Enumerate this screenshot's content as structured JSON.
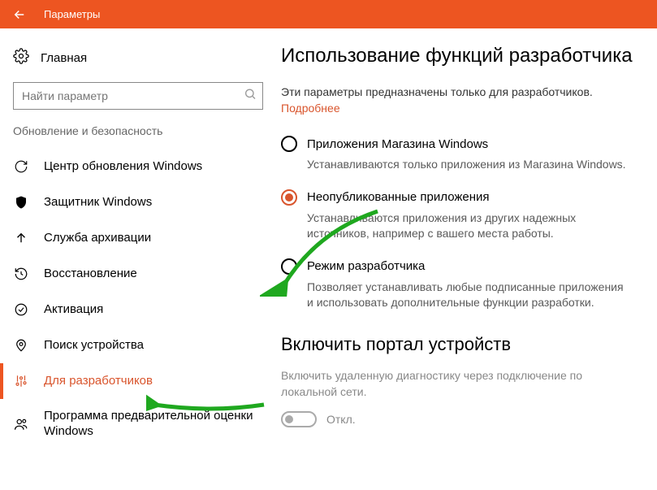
{
  "titlebar": {
    "title": "Параметры"
  },
  "sidebar": {
    "home": "Главная",
    "search_placeholder": "Найти параметр",
    "category": "Обновление и безопасность",
    "items": [
      {
        "label": "Центр обновления Windows"
      },
      {
        "label": "Защитник Windows"
      },
      {
        "label": "Служба архивации"
      },
      {
        "label": "Восстановление"
      },
      {
        "label": "Активация"
      },
      {
        "label": "Поиск устройства"
      },
      {
        "label": "Для разработчиков"
      },
      {
        "label": "Программа предварительной оценки Windows"
      }
    ]
  },
  "content": {
    "title": "Использование функций разработчика",
    "intro": "Эти параметры предназначены только для разработчиков.",
    "learn_more": "Подробнее",
    "options": [
      {
        "label": "Приложения Магазина Windows",
        "desc": "Устанавливаются только приложения из Магазина Windows."
      },
      {
        "label": "Неопубликованные приложения",
        "desc": "Устанавливаются приложения из других надежных источников, например с вашего места работы."
      },
      {
        "label": "Режим разработчика",
        "desc": "Позволяет устанавливать любые подписанные приложения и использовать дополнительные функции разработки."
      }
    ],
    "portal": {
      "title": "Включить портал устройств",
      "desc": "Включить удаленную диагностику через подключение по локальной сети.",
      "toggle_state": "Откл."
    }
  }
}
